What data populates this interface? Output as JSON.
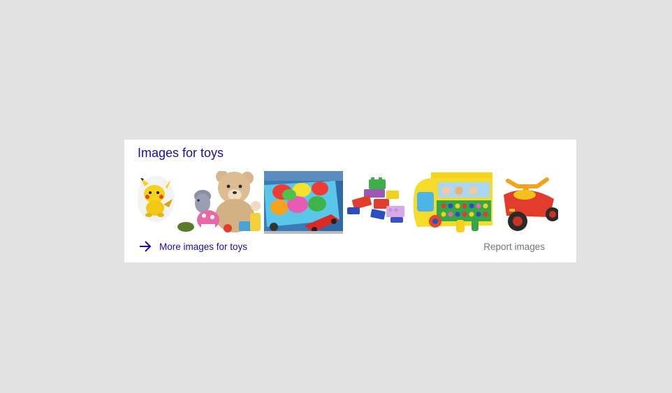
{
  "panel": {
    "title": "Images for toys",
    "more_link": "More images for toys",
    "report_link": "Report images"
  },
  "thumbnails": [
    {
      "name": "thumb-pikachu",
      "icon": "pikachu-plush-image"
    },
    {
      "name": "thumb-teddy-bear",
      "icon": "teddy-bear-plush-image"
    },
    {
      "name": "thumb-toy-cart-eggs",
      "icon": "toy-cart-eggs-image"
    },
    {
      "name": "thumb-building-blocks",
      "icon": "building-blocks-image"
    },
    {
      "name": "thumb-toy-bus",
      "icon": "toy-bus-image"
    },
    {
      "name": "thumb-tricycle",
      "icon": "tricycle-image"
    }
  ],
  "colors": {
    "page_background": "#e2e2e2",
    "link_blue": "#1a0dab",
    "muted_gray": "#70757a"
  }
}
